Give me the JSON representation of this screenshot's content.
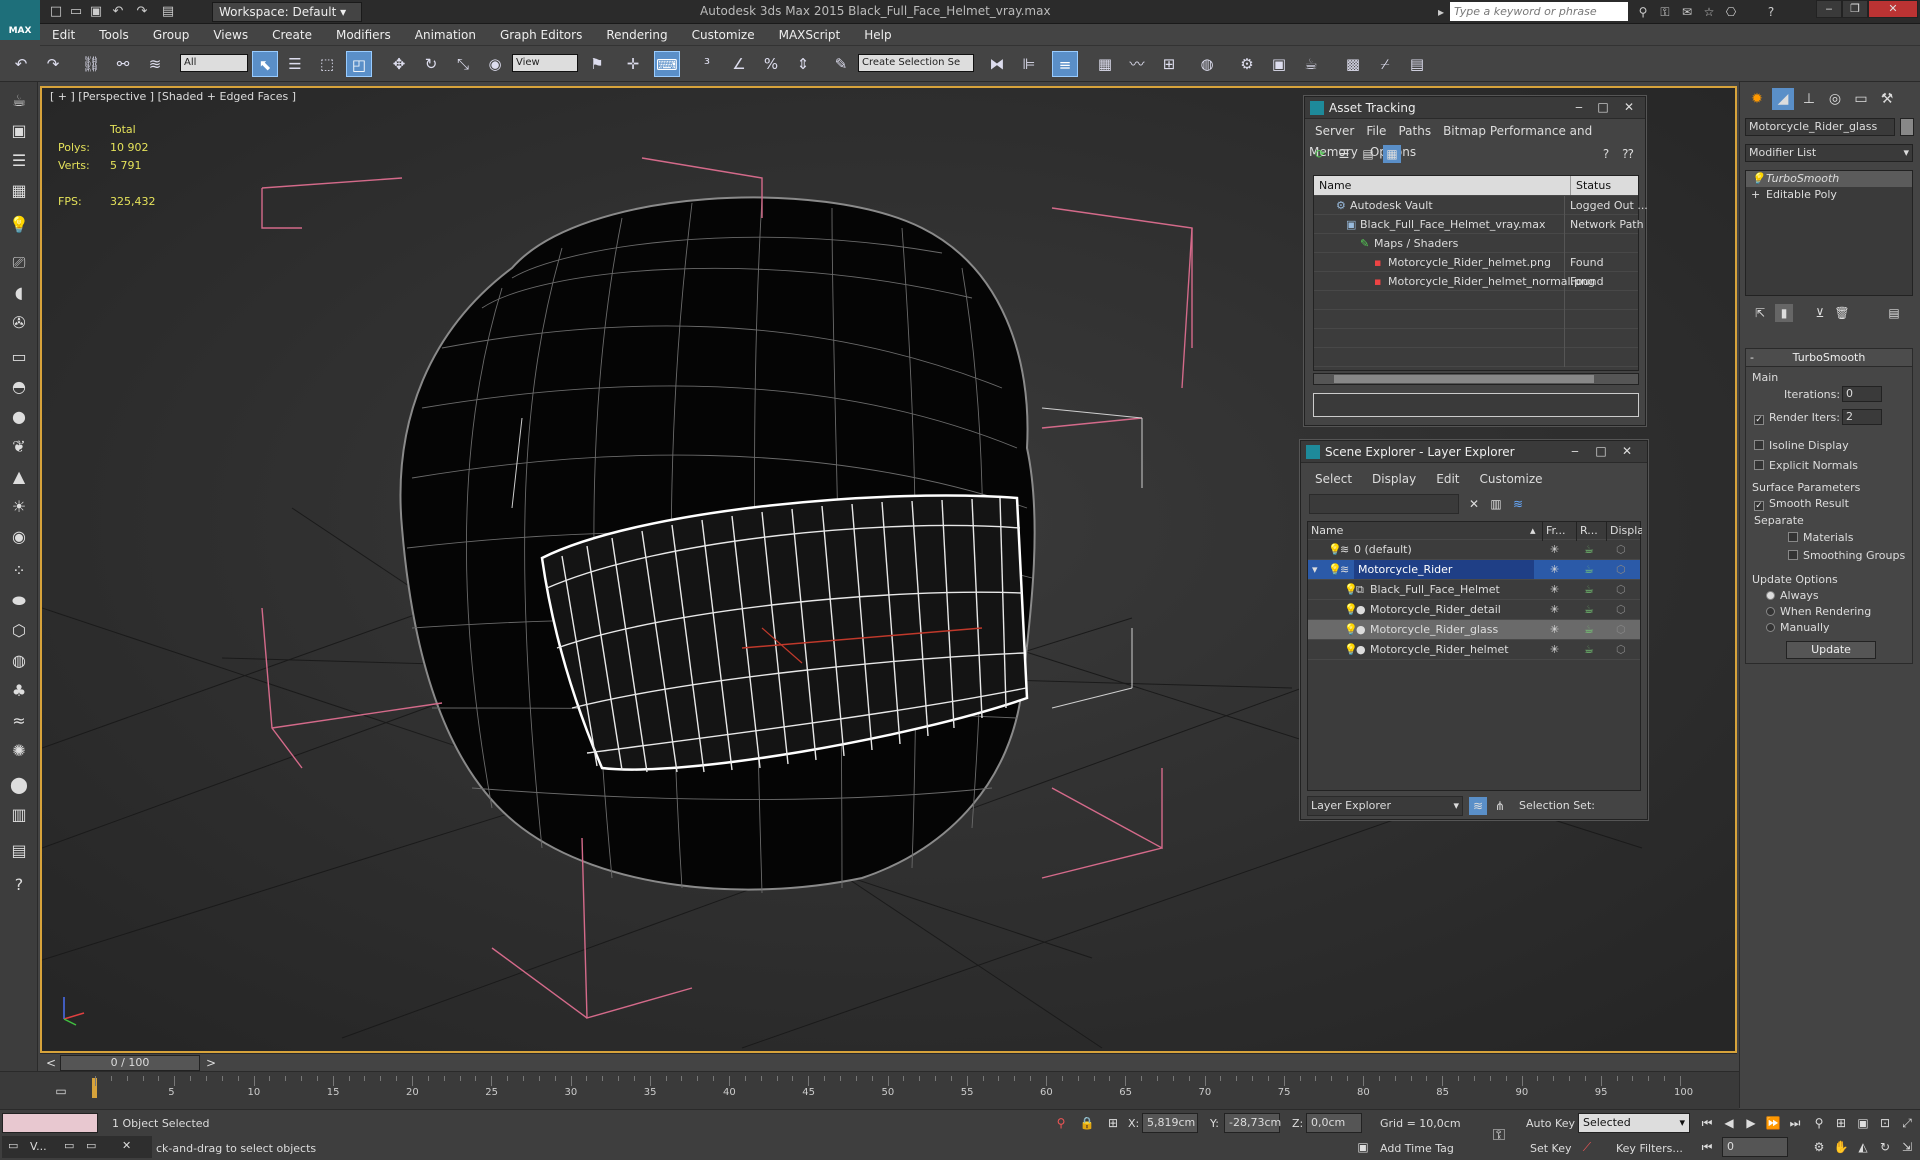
{
  "app": {
    "logo_text": "MAX",
    "workspace": "Workspace: Default",
    "window_title": "Autodesk 3ds Max  2015    Black_Full_Face_Helmet_vray.max",
    "search_placeholder": "Type a keyword or phrase"
  },
  "menu": [
    "Edit",
    "Tools",
    "Group",
    "Views",
    "Create",
    "Modifiers",
    "Animation",
    "Graph Editors",
    "Rendering",
    "Customize",
    "MAXScript",
    "Help"
  ],
  "toolbar": {
    "filter": "All",
    "ref_coord": "View",
    "selection_set": "Create Selection Se"
  },
  "viewport": {
    "label": "[ + ] [Perspective ] [Shaded + Edged Faces ]",
    "stats_header": "Total",
    "polys_label": "Polys:",
    "polys_value": "10 902",
    "verts_label": "Verts:",
    "verts_value": "5 791",
    "fps_label": "FPS:",
    "fps_value": "325,432"
  },
  "asset_tracking": {
    "title": "Asset Tracking",
    "menu": [
      "Server",
      "File",
      "Paths",
      "Bitmap Performance and Memory",
      "Options"
    ],
    "col_name": "Name",
    "col_status": "Status",
    "rows": [
      {
        "name": "Autodesk Vault",
        "status": "Logged Out ..."
      },
      {
        "name": "Black_Full_Face_Helmet_vray.max",
        "status": "Network Path"
      },
      {
        "name": "Maps / Shaders",
        "status": ""
      },
      {
        "name": "Motorcycle_Rider_helmet.png",
        "status": "Found"
      },
      {
        "name": "Motorcycle_Rider_helmet_normal.png",
        "status": "Found"
      }
    ]
  },
  "scene_explorer": {
    "title": "Scene Explorer - Layer Explorer",
    "menu": [
      "Select",
      "Display",
      "Edit",
      "Customize"
    ],
    "col_name": "Name",
    "col_fr": "Fr...",
    "col_r": "R...",
    "col_disp": "Displa...",
    "rows": [
      {
        "name": "0 (default)"
      },
      {
        "name": "Motorcycle_Rider"
      },
      {
        "name": "Black_Full_Face_Helmet"
      },
      {
        "name": "Motorcycle_Rider_detail"
      },
      {
        "name": "Motorcycle_Rider_glass"
      },
      {
        "name": "Motorcycle_Rider_helmet"
      }
    ],
    "footer_dropdown": "Layer Explorer",
    "selection_set_label": "Selection Set:"
  },
  "command_panel": {
    "object_name": "Motorcycle_Rider_glass",
    "modifier_list": "Modifier List",
    "stack": [
      "TurboSmooth",
      "Editable Poly"
    ],
    "turbosmooth_title": "TurboSmooth",
    "main_label": "Main",
    "iterations_label": "Iterations:",
    "iterations_value": "0",
    "render_iters_label": "Render Iters:",
    "render_iters_value": "2",
    "isoline": "Isoline Display",
    "explicit_normals": "Explicit Normals",
    "surface_params": "Surface Parameters",
    "smooth_result": "Smooth Result",
    "separate": "Separate",
    "materials": "Materials",
    "smoothing_groups": "Smoothing Groups",
    "update_options": "Update Options",
    "always": "Always",
    "when_rendering": "When Rendering",
    "manually": "Manually",
    "update_btn": "Update"
  },
  "timeline": {
    "frame": "0 / 100",
    "ticks": [
      "5",
      "10",
      "15",
      "20",
      "25",
      "30",
      "35",
      "40",
      "45",
      "50",
      "55",
      "60",
      "65",
      "70",
      "75",
      "80",
      "85",
      "90",
      "95",
      "100"
    ]
  },
  "status": {
    "selected": "1 Object Selected",
    "prompt": "ck-and-drag to select objects",
    "x_label": "X:",
    "x": "5,819cm",
    "y_label": "Y:",
    "y": "-28,73cm",
    "z_label": "Z:",
    "z": "0,0cm",
    "grid": "Grid = 10,0cm",
    "add_time_tag": "Add Time Tag",
    "auto_key": "Auto Key",
    "auto_key_mode": "Selected",
    "set_key": "Set Key",
    "key_filters": "Key Filters...",
    "current_frame": "0",
    "taskbar": "V..."
  }
}
